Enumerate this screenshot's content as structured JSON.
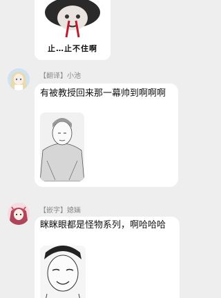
{
  "messages": [
    {
      "sticker_caption": "止…止不住啊"
    },
    {
      "tag": "【翻译】",
      "name": "小池",
      "text": "有被教授回来那一幕帅到啊啊啊"
    },
    {
      "tag": "【嵌字】",
      "name": "媳婳",
      "text": "眯眯眼都是怪物系列，啊哈哈哈"
    }
  ]
}
